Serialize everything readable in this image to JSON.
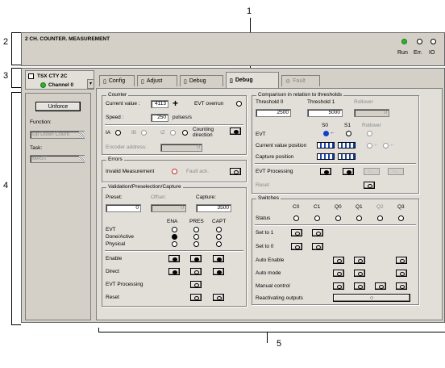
{
  "callouts": {
    "c1": "1",
    "c2": "2",
    "c3": "3",
    "c4": "4",
    "c5": "5"
  },
  "header": {
    "title": "2 CH. COUNTER. MEASUREMENT",
    "status": [
      "Run",
      "Err.",
      "IO"
    ]
  },
  "module": {
    "name": "TSX CTY 2C",
    "channel": "Channel 0"
  },
  "tabs": [
    "Config",
    "Adjust",
    "Debug",
    "Debug",
    "Fault"
  ],
  "left": {
    "unforce": "Unforce",
    "function_label": "Function:",
    "function_value": "Up Down Count",
    "task_label": "Task:",
    "task_value": "MAST"
  },
  "counter": {
    "title": "Counter",
    "current_label": "Current value :",
    "current_value": "4113",
    "evt_label": "EVT overrun",
    "speed_label": "Speed :",
    "speed_value": "250",
    "speed_unit": "pulses/s",
    "ia": "IA",
    "ib": "IB",
    "iz": "IZ",
    "counting_direction": "Counting direction",
    "encoder_label": "Encoder address:",
    "encoder_value": "0"
  },
  "errors": {
    "title": "Errors",
    "invalid": "Invalid Measurement",
    "fault_ack": "Fault ack."
  },
  "validation": {
    "title": "Validation/Preselection/Capture",
    "preset_label": "Preset:",
    "preset_value": "0",
    "offset_label": "Offset:",
    "offset_value": "0",
    "capture_label": "Capture:",
    "capture_value": "3500",
    "cols": [
      "ENA",
      "PRES",
      "CAPT"
    ],
    "rows": [
      "EVT",
      "Done/Active",
      "Physical"
    ],
    "actions": [
      "Enable",
      "Direct",
      "EVT Processing",
      "Reset"
    ]
  },
  "comparison": {
    "title": "Comparison in relation to thresholds",
    "th0_label": "Threshold 0",
    "th0_value": "2500",
    "th1_label": "Threshold 1",
    "th1_value": "5000",
    "rollover_label": "Rollover",
    "rollover_value": "0",
    "s0": "S0",
    "s1": "S1",
    "rollover2": "Rollover",
    "rows": [
      "EVT",
      "Current value position",
      "Capture position",
      "EVT Processing",
      "Reset"
    ]
  },
  "switches": {
    "title": "Switches",
    "cols": [
      "C0",
      "C1",
      "Q0",
      "Q1",
      "Q2",
      "Q3"
    ],
    "rows": [
      "Status",
      "Set to 1",
      "Set to 0",
      "Auto Enable",
      "Auto mode",
      "Manual control",
      "Reactivating outputs"
    ]
  }
}
